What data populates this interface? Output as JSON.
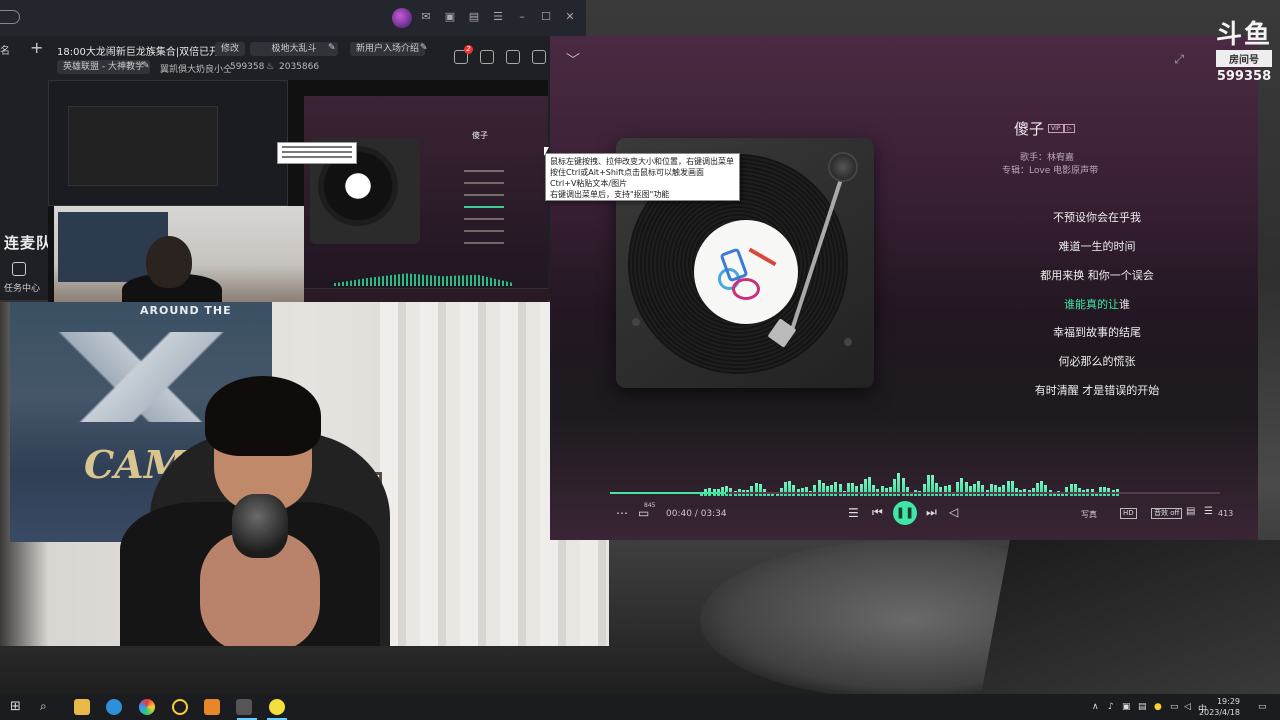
{
  "left_app": {
    "sidebar_label": "名",
    "room_title": "18:00大龙闹新巨龙族集合|双倍已开",
    "edit_label": "修改",
    "category_chip": "极地大乱斗",
    "newbie_chip": "新用户入场介绍",
    "league_chip": "英雄联盟 - 大神教学",
    "streamer_meta": "翼凯俱大奶良小仝",
    "room_id": "599358",
    "hot_value": "2035866",
    "notification_badge": "2",
    "lianmai_label": "连麦队友 水龙头",
    "task_center_label": "任务中心"
  },
  "tooltip": {
    "lines": [
      "鼠标左键按拽、拉伸改变大小和位置，右键调出菜单",
      "按住Ctrl或Alt+Shift点击鼠标可以触发画面",
      "Ctrl+V粘贴文本/图片",
      "右键调出菜单后，支持\"抠图\"功能"
    ]
  },
  "webcam": {
    "tapestry_text": "AROUND THE",
    "camp_text": "CAM"
  },
  "player": {
    "song_title": "傻子",
    "tag_vip": "VIP",
    "tag_mv": "▷",
    "singer": "歌手：林宥嘉",
    "album": "专辑：Love 电影原声带",
    "lyrics": [
      "不预设你会在乎我",
      "难道一生的时间",
      "都用来换 和你一个误会",
      "谁能真的让谁",
      "幸福到故事的结尾",
      "何必那么的慌张",
      "有时清醒 才是错误的开始"
    ],
    "current_lyric_played": "谁能真的让",
    "current_lyric_rest": "谁",
    "progress_fraction": 0.19,
    "comment_count": "845",
    "time_display": "00:40 / 03:34",
    "write_label": "写真",
    "quality_label": "HD",
    "effect_label": "音效 off",
    "playlist_count": "413",
    "accent_color": "#3fe6a4"
  },
  "watermark": {
    "brand": "斗鱼",
    "tag": "房间号",
    "room_number": "599358"
  },
  "taskbar": {
    "clock_time": "19:29",
    "clock_date": "2023/4/18",
    "ime_label": "中"
  }
}
